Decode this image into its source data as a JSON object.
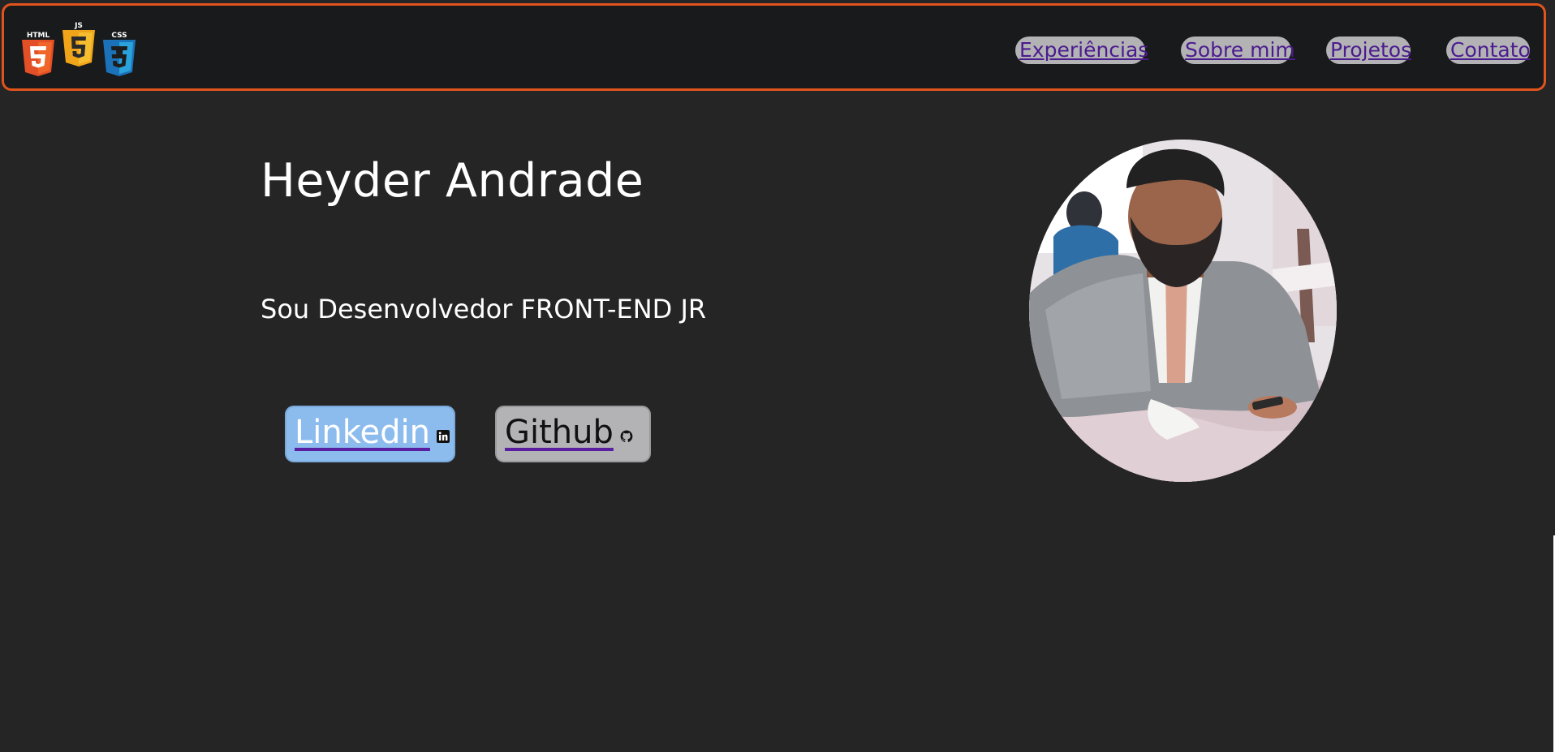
{
  "header": {
    "logos": [
      {
        "icon": "html5-logo-icon",
        "text": "HTML",
        "color": "#e34f26"
      },
      {
        "icon": "js-logo-icon",
        "text": "JS",
        "color": "#f0a419"
      },
      {
        "icon": "css3-logo-icon",
        "text": "CSS",
        "color": "#1c72b8"
      }
    ],
    "border_color": "#e1541d",
    "nav": [
      {
        "label": "Experiências"
      },
      {
        "label": "Sobre mim"
      },
      {
        "label": "Projetos"
      },
      {
        "label": "Contato"
      }
    ]
  },
  "hero": {
    "name": "Heyder Andrade",
    "subtitle": "Sou Desenvolvedor FRONT-END JR",
    "buttons": {
      "linkedin": {
        "label": "Linkedin",
        "icon": "linkedin-icon",
        "color": "#8cbcee"
      },
      "github": {
        "label": "Github",
        "icon": "github-icon",
        "color": "#b3b3b5"
      }
    }
  },
  "colors": {
    "background": "#262526",
    "header_bg": "#181a1b",
    "link_color": "#4b1b8f"
  }
}
